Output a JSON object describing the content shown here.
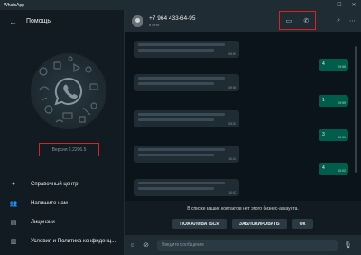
{
  "window": {
    "title": "WhatsApp",
    "minimize": "—",
    "maximize": "☐",
    "close": "✕"
  },
  "left_panel": {
    "title": "Помощь",
    "version": "Версия 2.2206.5",
    "menu": [
      {
        "label": "Справочный центр",
        "icon": "help-circle-icon",
        "glyph": "●"
      },
      {
        "label": "Напишите нам",
        "icon": "people-icon",
        "glyph": "👥"
      },
      {
        "label": "Лицензии",
        "icon": "document-icon",
        "glyph": "▤"
      },
      {
        "label": "Условия и Политика конфиденц...",
        "icon": "policy-icon",
        "glyph": "▥"
      }
    ]
  },
  "chat": {
    "contact_name": "+7 964 433-64-95",
    "contact_sub": "в сети",
    "messages_in": [
      {
        "time": "09:51"
      },
      {
        "time": "09:56"
      },
      {
        "time": "09:57"
      },
      {
        "time": "10:02"
      },
      {
        "time": "10:02"
      }
    ],
    "messages_out": [
      {
        "count": "4",
        "time": "09:58"
      },
      {
        "count": "1",
        "time": "09:59"
      },
      {
        "count": "3",
        "time": "10:01"
      },
      {
        "count": "4",
        "time": "10:02"
      }
    ],
    "banner_text": "В списке ваших контактов нет этого бизнес-аккаунта.",
    "buttons": {
      "report": "ПОЖАЛОВАТЬСЯ",
      "block": "ЗАБЛОКИРОВАТЬ",
      "ok": "ОК"
    },
    "input_placeholder": "Введите сообщение"
  },
  "colors": {
    "accent_out": "#005c4b",
    "highlight": "#e02020",
    "panel": "#111b21"
  }
}
